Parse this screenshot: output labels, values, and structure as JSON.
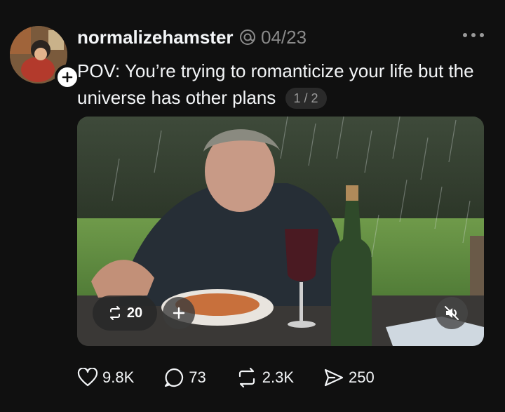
{
  "post": {
    "author": {
      "username": "normalizehamster",
      "avatar_icon": "avatar-image",
      "follow_icon": "plus-icon"
    },
    "date": "04/23",
    "caption": "POV: You’re trying to romanticize your life but the universe has other plans",
    "page_indicator": "1 / 2",
    "media": {
      "repost_count": "20",
      "repost_icon": "repost-icon",
      "add_icon": "plus-icon",
      "mute_icon": "muted-speaker-icon"
    },
    "stats": {
      "likes": "9.8K",
      "replies": "73",
      "reposts": "2.3K",
      "shares": "250"
    }
  },
  "colors": {
    "background": "#101010",
    "text_primary": "#f3f5f7",
    "text_secondary": "#8a8a8a"
  }
}
